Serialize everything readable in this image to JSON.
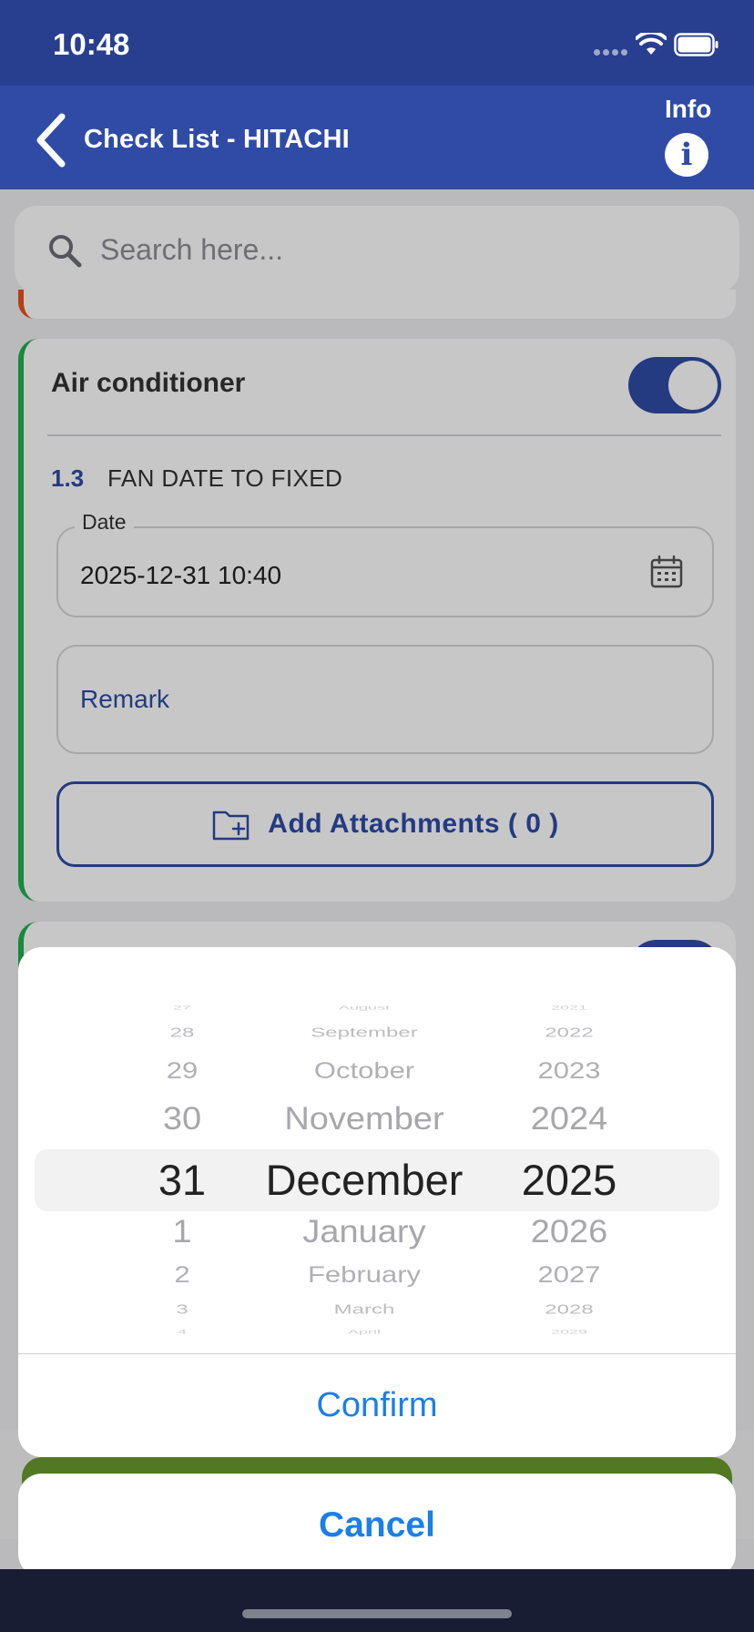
{
  "status_bar": {
    "time": "10:48"
  },
  "header": {
    "title": "Check List - HITACHI",
    "info_label": "Info",
    "info_glyph": "i"
  },
  "search": {
    "placeholder": "Search here..."
  },
  "card": {
    "title": "Air conditioner",
    "toggle_on": true,
    "item_number": "1.3",
    "item_title": "FAN DATE TO FIXED",
    "date_label": "Date",
    "date_value": "2025-12-31 10:40",
    "remark_label": "Remark",
    "attach_label": "Add Attachments ( 0 )"
  },
  "picker": {
    "days": [
      "27",
      "28",
      "29",
      "30",
      "31",
      "1",
      "2",
      "3",
      "4"
    ],
    "months": [
      "August",
      "September",
      "October",
      "November",
      "December",
      "January",
      "February",
      "March",
      "April"
    ],
    "years": [
      "2021",
      "2022",
      "2023",
      "2024",
      "2025",
      "2026",
      "2027",
      "2028",
      "2029"
    ],
    "selected": {
      "day": "31",
      "month": "December",
      "year": "2025"
    },
    "confirm_label": "Confirm",
    "cancel_label": "Cancel"
  },
  "colors": {
    "header_bg": "#2f4ba6",
    "status_bg": "#283f8f",
    "accent_green": "#21b04f",
    "accent_orange": "#e8531d",
    "action_blue": "#1a7fe8"
  },
  "icons": [
    "back-chevron-icon",
    "info-icon",
    "search-icon",
    "calendar-icon",
    "folder-add-icon",
    "wifi-icon",
    "battery-icon",
    "signal-icon"
  ]
}
